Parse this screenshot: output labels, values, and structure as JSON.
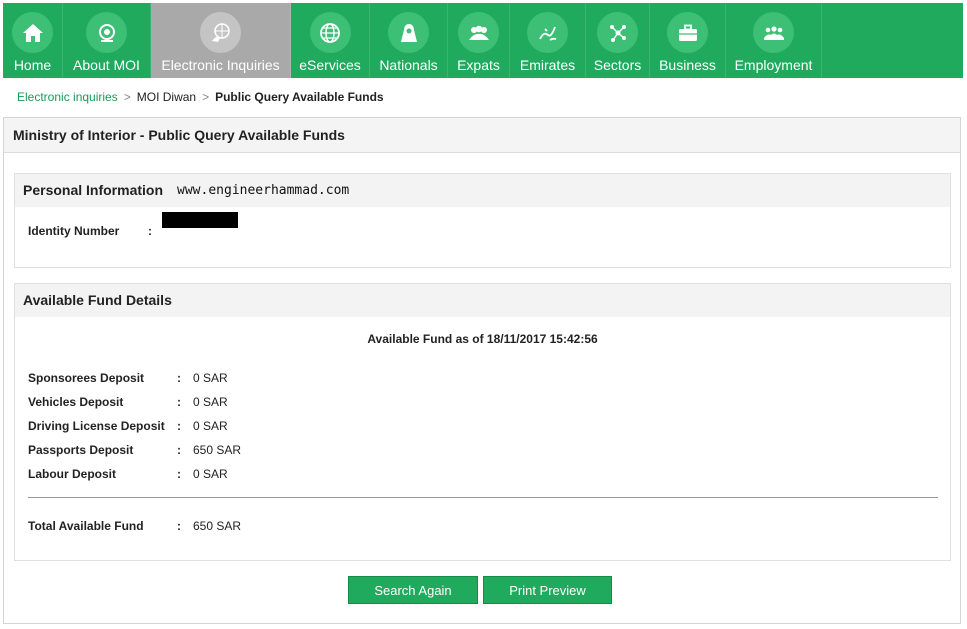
{
  "nav": {
    "items": [
      {
        "label": "Home",
        "icon": "home-icon"
      },
      {
        "label": "About MOI",
        "icon": "emblem-icon"
      },
      {
        "label": "Electronic Inquiries",
        "icon": "globe-hand-icon",
        "active": true
      },
      {
        "label": "eServices",
        "icon": "globe-icon"
      },
      {
        "label": "Nationals",
        "icon": "person-icon"
      },
      {
        "label": "Expats",
        "icon": "group-icon"
      },
      {
        "label": "Emirates",
        "icon": "calligraphy-icon"
      },
      {
        "label": "Sectors",
        "icon": "network-icon"
      },
      {
        "label": "Business",
        "icon": "briefcase-icon"
      },
      {
        "label": "Employment",
        "icon": "people-icon"
      }
    ]
  },
  "breadcrumb": {
    "link": "Electronic inquiries",
    "middle": "MOI Diwan",
    "current": "Public Query Available Funds"
  },
  "page": {
    "title": "Ministry of Interior - Public Query Available Funds"
  },
  "personal": {
    "title": "Personal Information",
    "watermark": "www.engineerhammad.com",
    "identity_label": "Identity Number",
    "colon": ":"
  },
  "funds": {
    "title": "Available Fund Details",
    "as_of": "Available Fund as of 18/11/2017 15:42:56",
    "rows": [
      {
        "label": "Sponsorees Deposit",
        "value": "0 SAR"
      },
      {
        "label": "Vehicles Deposit",
        "value": "0 SAR"
      },
      {
        "label": "Driving License Deposit",
        "value": "0 SAR"
      },
      {
        "label": "Passports Deposit",
        "value": "650 SAR"
      },
      {
        "label": "Labour Deposit",
        "value": "0 SAR"
      }
    ],
    "total_label": "Total Available Fund",
    "total_value": "650 SAR"
  },
  "buttons": {
    "search_again": "Search Again",
    "print_preview": "Print Preview"
  },
  "colors": {
    "brand_green": "#1faa5d",
    "active_tab": "#a9a9a9"
  }
}
